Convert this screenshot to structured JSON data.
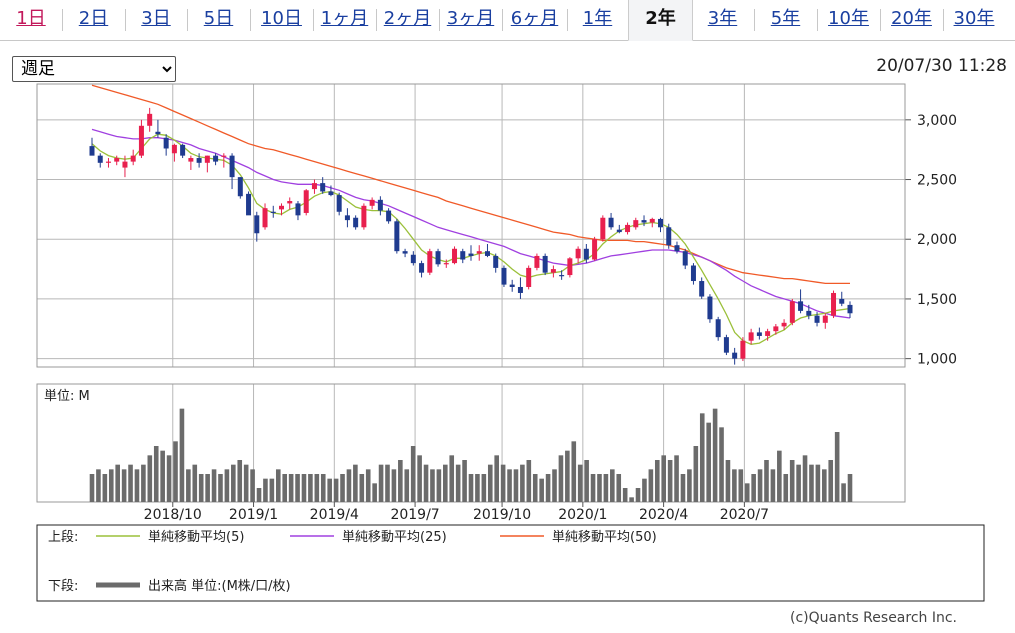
{
  "tabs": [
    {
      "label": "1日",
      "active": false
    },
    {
      "label": "2日",
      "active": false
    },
    {
      "label": "3日",
      "active": false
    },
    {
      "label": "5日",
      "active": false
    },
    {
      "label": "10日",
      "active": false
    },
    {
      "label": "1ヶ月",
      "active": false
    },
    {
      "label": "2ヶ月",
      "active": false
    },
    {
      "label": "3ヶ月",
      "active": false
    },
    {
      "label": "6ヶ月",
      "active": false
    },
    {
      "label": "1年",
      "active": false
    },
    {
      "label": "2年",
      "active": true
    },
    {
      "label": "3年",
      "active": false
    },
    {
      "label": "5年",
      "active": false
    },
    {
      "label": "10年",
      "active": false
    },
    {
      "label": "20年",
      "active": false
    },
    {
      "label": "30年",
      "active": false
    }
  ],
  "period_select": {
    "selected": "週足"
  },
  "timestamp": "20/07/30 11:28",
  "copyright": "(c)Quants Research Inc.",
  "colors": {
    "up": "#e8204e",
    "down": "#1f3b8f",
    "ma5": "#9bc03a",
    "ma25": "#a040e0",
    "ma50": "#f05a28",
    "volume": "#6b6b6b",
    "grid": "#b8b8b8"
  },
  "chart_data": {
    "type": "candlestick",
    "interval": "weekly",
    "price_ticks": [
      "3,000",
      "2,500",
      "2,000",
      "1,500",
      "1,000"
    ],
    "price_tick_values": [
      3000,
      2500,
      2000,
      1500,
      1000
    ],
    "ylim": [
      930,
      3300
    ],
    "x_labels": [
      "2018/10",
      "2019/1",
      "2019/4",
      "2019/7",
      "2019/10",
      "2020/1",
      "2020/4",
      "2020/7"
    ],
    "x_label_weeks": [
      13,
      26,
      39,
      52,
      66,
      79,
      92,
      105
    ],
    "candles": [
      [
        2780,
        2850,
        2720,
        2700
      ],
      [
        2700,
        2720,
        2600,
        2640
      ],
      [
        2640,
        2680,
        2600,
        2650
      ],
      [
        2650,
        2700,
        2620,
        2680
      ],
      [
        2600,
        2700,
        2520,
        2650
      ],
      [
        2650,
        2750,
        2620,
        2700
      ],
      [
        2700,
        3000,
        2680,
        2950
      ],
      [
        2950,
        3100,
        2900,
        3050
      ],
      [
        2900,
        3000,
        2850,
        2880
      ],
      [
        2850,
        2880,
        2700,
        2760
      ],
      [
        2720,
        2800,
        2650,
        2790
      ],
      [
        2790,
        2800,
        2680,
        2700
      ],
      [
        2650,
        2700,
        2580,
        2680
      ],
      [
        2680,
        2720,
        2600,
        2640
      ],
      [
        2640,
        2700,
        2560,
        2700
      ],
      [
        2700,
        2720,
        2620,
        2650
      ],
      [
        2690,
        2720,
        2600,
        2700
      ],
      [
        2700,
        2720,
        2420,
        2520
      ],
      [
        2520,
        2520,
        2340,
        2360
      ],
      [
        2380,
        2400,
        2250,
        2200
      ],
      [
        2200,
        2230,
        1980,
        2050
      ],
      [
        2100,
        2300,
        2080,
        2260
      ],
      [
        2230,
        2280,
        2180,
        2220
      ],
      [
        2250,
        2300,
        2200,
        2280
      ],
      [
        2300,
        2350,
        2250,
        2320
      ],
      [
        2300,
        2320,
        2160,
        2200
      ],
      [
        2220,
        2420,
        2200,
        2410
      ],
      [
        2420,
        2500,
        2380,
        2470
      ],
      [
        2470,
        2520,
        2380,
        2400
      ],
      [
        2400,
        2450,
        2360,
        2370
      ],
      [
        2370,
        2390,
        2200,
        2230
      ],
      [
        2200,
        2260,
        2100,
        2160
      ],
      [
        2180,
        2200,
        2080,
        2100
      ],
      [
        2100,
        2300,
        2080,
        2280
      ],
      [
        2280,
        2350,
        2250,
        2330
      ],
      [
        2330,
        2360,
        2200,
        2240
      ],
      [
        2240,
        2260,
        2130,
        2150
      ],
      [
        2150,
        2170,
        1880,
        1900
      ],
      [
        1900,
        1920,
        1850,
        1880
      ],
      [
        1870,
        1900,
        1780,
        1800
      ],
      [
        1800,
        1820,
        1680,
        1720
      ],
      [
        1720,
        1920,
        1700,
        1900
      ],
      [
        1900,
        1920,
        1770,
        1790
      ],
      [
        1790,
        1830,
        1760,
        1800
      ],
      [
        1800,
        1940,
        1790,
        1920
      ],
      [
        1900,
        1920,
        1800,
        1830
      ],
      [
        1880,
        1950,
        1820,
        1860
      ],
      [
        1880,
        1950,
        1820,
        1900
      ],
      [
        1900,
        1960,
        1850,
        1860
      ],
      [
        1860,
        1880,
        1720,
        1760
      ],
      [
        1760,
        1780,
        1600,
        1620
      ],
      [
        1620,
        1660,
        1560,
        1600
      ],
      [
        1600,
        1680,
        1500,
        1550
      ],
      [
        1600,
        1780,
        1580,
        1760
      ],
      [
        1760,
        1880,
        1740,
        1860
      ],
      [
        1860,
        1880,
        1700,
        1720
      ],
      [
        1720,
        1780,
        1680,
        1750
      ],
      [
        1700,
        1740,
        1660,
        1690
      ],
      [
        1700,
        1850,
        1680,
        1840
      ],
      [
        1840,
        1940,
        1800,
        1920
      ],
      [
        1920,
        1960,
        1800,
        1830
      ],
      [
        1830,
        2020,
        1820,
        2000
      ],
      [
        2000,
        2200,
        1980,
        2180
      ],
      [
        2180,
        2220,
        2080,
        2100
      ],
      [
        2080,
        2120,
        2050,
        2060
      ],
      [
        2060,
        2140,
        2040,
        2120
      ],
      [
        2100,
        2180,
        2080,
        2160
      ],
      [
        2160,
        2200,
        2110,
        2140
      ],
      [
        2140,
        2180,
        2100,
        2170
      ],
      [
        2170,
        2180,
        2060,
        2100
      ],
      [
        2100,
        2130,
        1920,
        1950
      ],
      [
        1950,
        1980,
        1880,
        1900
      ],
      [
        1900,
        1920,
        1750,
        1780
      ],
      [
        1780,
        1800,
        1620,
        1650
      ],
      [
        1650,
        1680,
        1500,
        1520
      ],
      [
        1520,
        1540,
        1300,
        1330
      ],
      [
        1330,
        1350,
        1150,
        1180
      ],
      [
        1180,
        1200,
        1030,
        1050
      ],
      [
        1050,
        1090,
        950,
        1000
      ],
      [
        1000,
        1180,
        980,
        1150
      ],
      [
        1150,
        1250,
        1120,
        1220
      ],
      [
        1220,
        1260,
        1160,
        1190
      ],
      [
        1190,
        1250,
        1150,
        1230
      ],
      [
        1230,
        1290,
        1200,
        1270
      ],
      [
        1270,
        1330,
        1240,
        1300
      ],
      [
        1300,
        1500,
        1280,
        1480
      ],
      [
        1480,
        1580,
        1380,
        1400
      ],
      [
        1400,
        1450,
        1330,
        1360
      ],
      [
        1360,
        1390,
        1270,
        1300
      ],
      [
        1300,
        1380,
        1250,
        1360
      ],
      [
        1360,
        1570,
        1340,
        1550
      ],
      [
        1500,
        1560,
        1440,
        1460
      ],
      [
        1450,
        1480,
        1340,
        1380
      ]
    ],
    "ma5": [
      2800,
      2740,
      2700,
      2680,
      2670,
      2680,
      2760,
      2840,
      2880,
      2870,
      2830,
      2780,
      2720,
      2690,
      2680,
      2670,
      2660,
      2620,
      2540,
      2430,
      2300,
      2250,
      2220,
      2210,
      2250,
      2270,
      2310,
      2360,
      2390,
      2400,
      2370,
      2320,
      2270,
      2250,
      2240,
      2240,
      2230,
      2170,
      2090,
      2000,
      1910,
      1860,
      1830,
      1810,
      1840,
      1840,
      1860,
      1880,
      1890,
      1860,
      1810,
      1750,
      1700,
      1680,
      1700,
      1710,
      1720,
      1730,
      1780,
      1800,
      1830,
      1880,
      1960,
      2020,
      2070,
      2100,
      2120,
      2130,
      2140,
      2130,
      2100,
      2040,
      1960,
      1850,
      1740,
      1620,
      1500,
      1370,
      1220,
      1150,
      1120,
      1130,
      1170,
      1210,
      1240,
      1300,
      1340,
      1360,
      1370,
      1380,
      1400,
      1410,
      1420
    ],
    "ma25": [
      2920,
      2900,
      2880,
      2860,
      2850,
      2840,
      2840,
      2850,
      2850,
      2840,
      2830,
      2810,
      2790,
      2760,
      2740,
      2720,
      2690,
      2660,
      2630,
      2600,
      2560,
      2530,
      2500,
      2480,
      2470,
      2460,
      2460,
      2460,
      2450,
      2430,
      2410,
      2380,
      2350,
      2330,
      2320,
      2300,
      2280,
      2250,
      2220,
      2190,
      2160,
      2130,
      2100,
      2080,
      2060,
      2040,
      2020,
      2000,
      1980,
      1960,
      1940,
      1910,
      1880,
      1860,
      1840,
      1820,
      1800,
      1790,
      1780,
      1790,
      1800,
      1820,
      1840,
      1860,
      1870,
      1880,
      1890,
      1900,
      1910,
      1910,
      1910,
      1900,
      1890,
      1870,
      1850,
      1820,
      1780,
      1740,
      1690,
      1650,
      1610,
      1580,
      1550,
      1520,
      1500,
      1480,
      1460,
      1430,
      1400,
      1380,
      1360,
      1350,
      1340
    ],
    "ma50": [
      3290,
      3270,
      3250,
      3230,
      3210,
      3190,
      3170,
      3150,
      3130,
      3100,
      3070,
      3040,
      3010,
      2980,
      2950,
      2920,
      2890,
      2860,
      2830,
      2800,
      2780,
      2760,
      2750,
      2730,
      2710,
      2690,
      2670,
      2650,
      2630,
      2610,
      2590,
      2570,
      2550,
      2530,
      2510,
      2490,
      2470,
      2450,
      2430,
      2410,
      2390,
      2370,
      2350,
      2320,
      2300,
      2280,
      2260,
      2240,
      2220,
      2200,
      2180,
      2160,
      2140,
      2120,
      2100,
      2080,
      2060,
      2050,
      2040,
      2020,
      2010,
      2000,
      1990,
      1990,
      1990,
      1990,
      1980,
      1980,
      1970,
      1960,
      1950,
      1930,
      1910,
      1880,
      1850,
      1820,
      1790,
      1760,
      1740,
      1720,
      1710,
      1700,
      1690,
      1680,
      1670,
      1670,
      1660,
      1650,
      1640,
      1630,
      1630,
      1630,
      1630
    ],
    "volume_unit_label": "単位: M",
    "volume_ylim": [
      0,
      12
    ],
    "volume": [
      3.0,
      3.5,
      3.0,
      3.5,
      4.0,
      3.5,
      4.0,
      3.5,
      4.0,
      5.0,
      6.0,
      5.5,
      5.0,
      6.5,
      10.0,
      3.5,
      4.0,
      3.0,
      3.0,
      3.5,
      3.0,
      3.5,
      4.0,
      4.5,
      4.0,
      3.5,
      1.5,
      2.5,
      2.5,
      3.5,
      3.0,
      3.0,
      3.0,
      3.0,
      3.0,
      3.0,
      3.0,
      2.5,
      2.5,
      3.0,
      3.5,
      4.0,
      3.0,
      3.5,
      2.0,
      4.0,
      4.0,
      3.5,
      4.5,
      3.5,
      6.0,
      5.0,
      4.0,
      3.5,
      3.5,
      4.0,
      5.0,
      4.0,
      4.5,
      3.0,
      3.0,
      3.0,
      4.0,
      5.0,
      4.0,
      3.5,
      3.5,
      4.0,
      4.5,
      3.0,
      2.5,
      3.0,
      3.5,
      5.0,
      5.5,
      6.5,
      4.0,
      4.5,
      3.0,
      3.0,
      3.0,
      3.5,
      3.0,
      1.5,
      0.5,
      1.5,
      2.5,
      3.5,
      4.5,
      5.0,
      4.5,
      5.0,
      3.0,
      3.5,
      6.0,
      9.5,
      8.5,
      10.0,
      8.0,
      4.5,
      3.5,
      3.5,
      2.0,
      3.0,
      3.5,
      4.5,
      3.5,
      5.5,
      3.0,
      4.5,
      4.0,
      5.0,
      4.0,
      4.0,
      3.5,
      4.5,
      7.5,
      2.0,
      3.0
    ],
    "volume_labels": [],
    "legend": {
      "upper_label": "上段:",
      "lower_label": "下段:",
      "series": [
        {
          "name": "単純移動平均(5)",
          "color": "#9bc03a"
        },
        {
          "name": "単純移動平均(25)",
          "color": "#a040e0"
        },
        {
          "name": "単純移動平均(50)",
          "color": "#f05a28"
        }
      ],
      "volume_series": {
        "name": "出来高 単位:(M株/口/枚)",
        "color": "#6b6b6b"
      }
    }
  }
}
